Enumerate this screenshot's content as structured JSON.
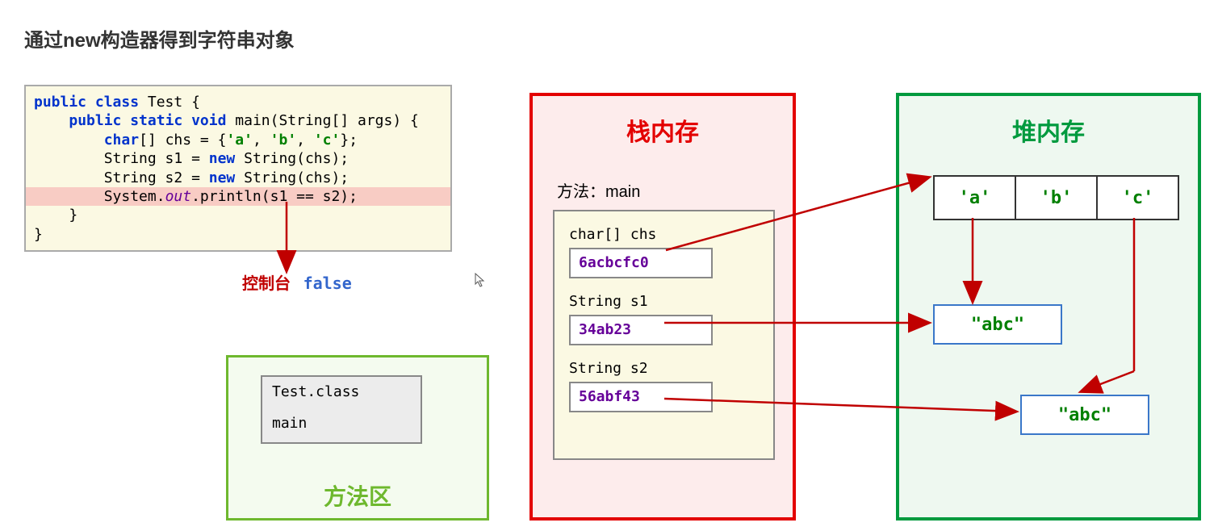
{
  "title": "通过new构造器得到字符串对象",
  "code": {
    "l1_kw1": "public class",
    "l1_rest": " Test {",
    "l2_kw1": "public static void",
    "l2_rest": " main(String[] args) {",
    "l3_kw1": "char",
    "l3_rest1": "[] chs = {",
    "l3_a": "'a'",
    "l3_c1": ", ",
    "l3_b": "'b'",
    "l3_c2": ", ",
    "l3_c": "'c'",
    "l3_rest2": "};",
    "l4_a": "String s1 = ",
    "l4_new": "new",
    "l4_b": " String(chs);",
    "l5_a": "String s2 = ",
    "l5_new": "new",
    "l5_b": " String(chs);",
    "l6_a": "System.",
    "l6_out": "out",
    "l6_b": ".println(s1 == s2);",
    "l7": "    }",
    "l8": "}"
  },
  "console": {
    "label": "控制台",
    "value": "false"
  },
  "method_area": {
    "class_file": "Test.class",
    "method_name": "main",
    "label": "方法区"
  },
  "stack": {
    "header": "栈内存",
    "method_label": "方法：main",
    "var1_label": "char[] chs",
    "var1_value": "6acbcfc0",
    "var2_label": "String s1",
    "var2_value": "34ab23",
    "var3_label": "String s2",
    "var3_value": "56abf43"
  },
  "heap": {
    "header": "堆内存",
    "char_cells": [
      "'a'",
      "'b'",
      "'c'"
    ],
    "str1": "\"abc\"",
    "str2": "\"abc\""
  }
}
